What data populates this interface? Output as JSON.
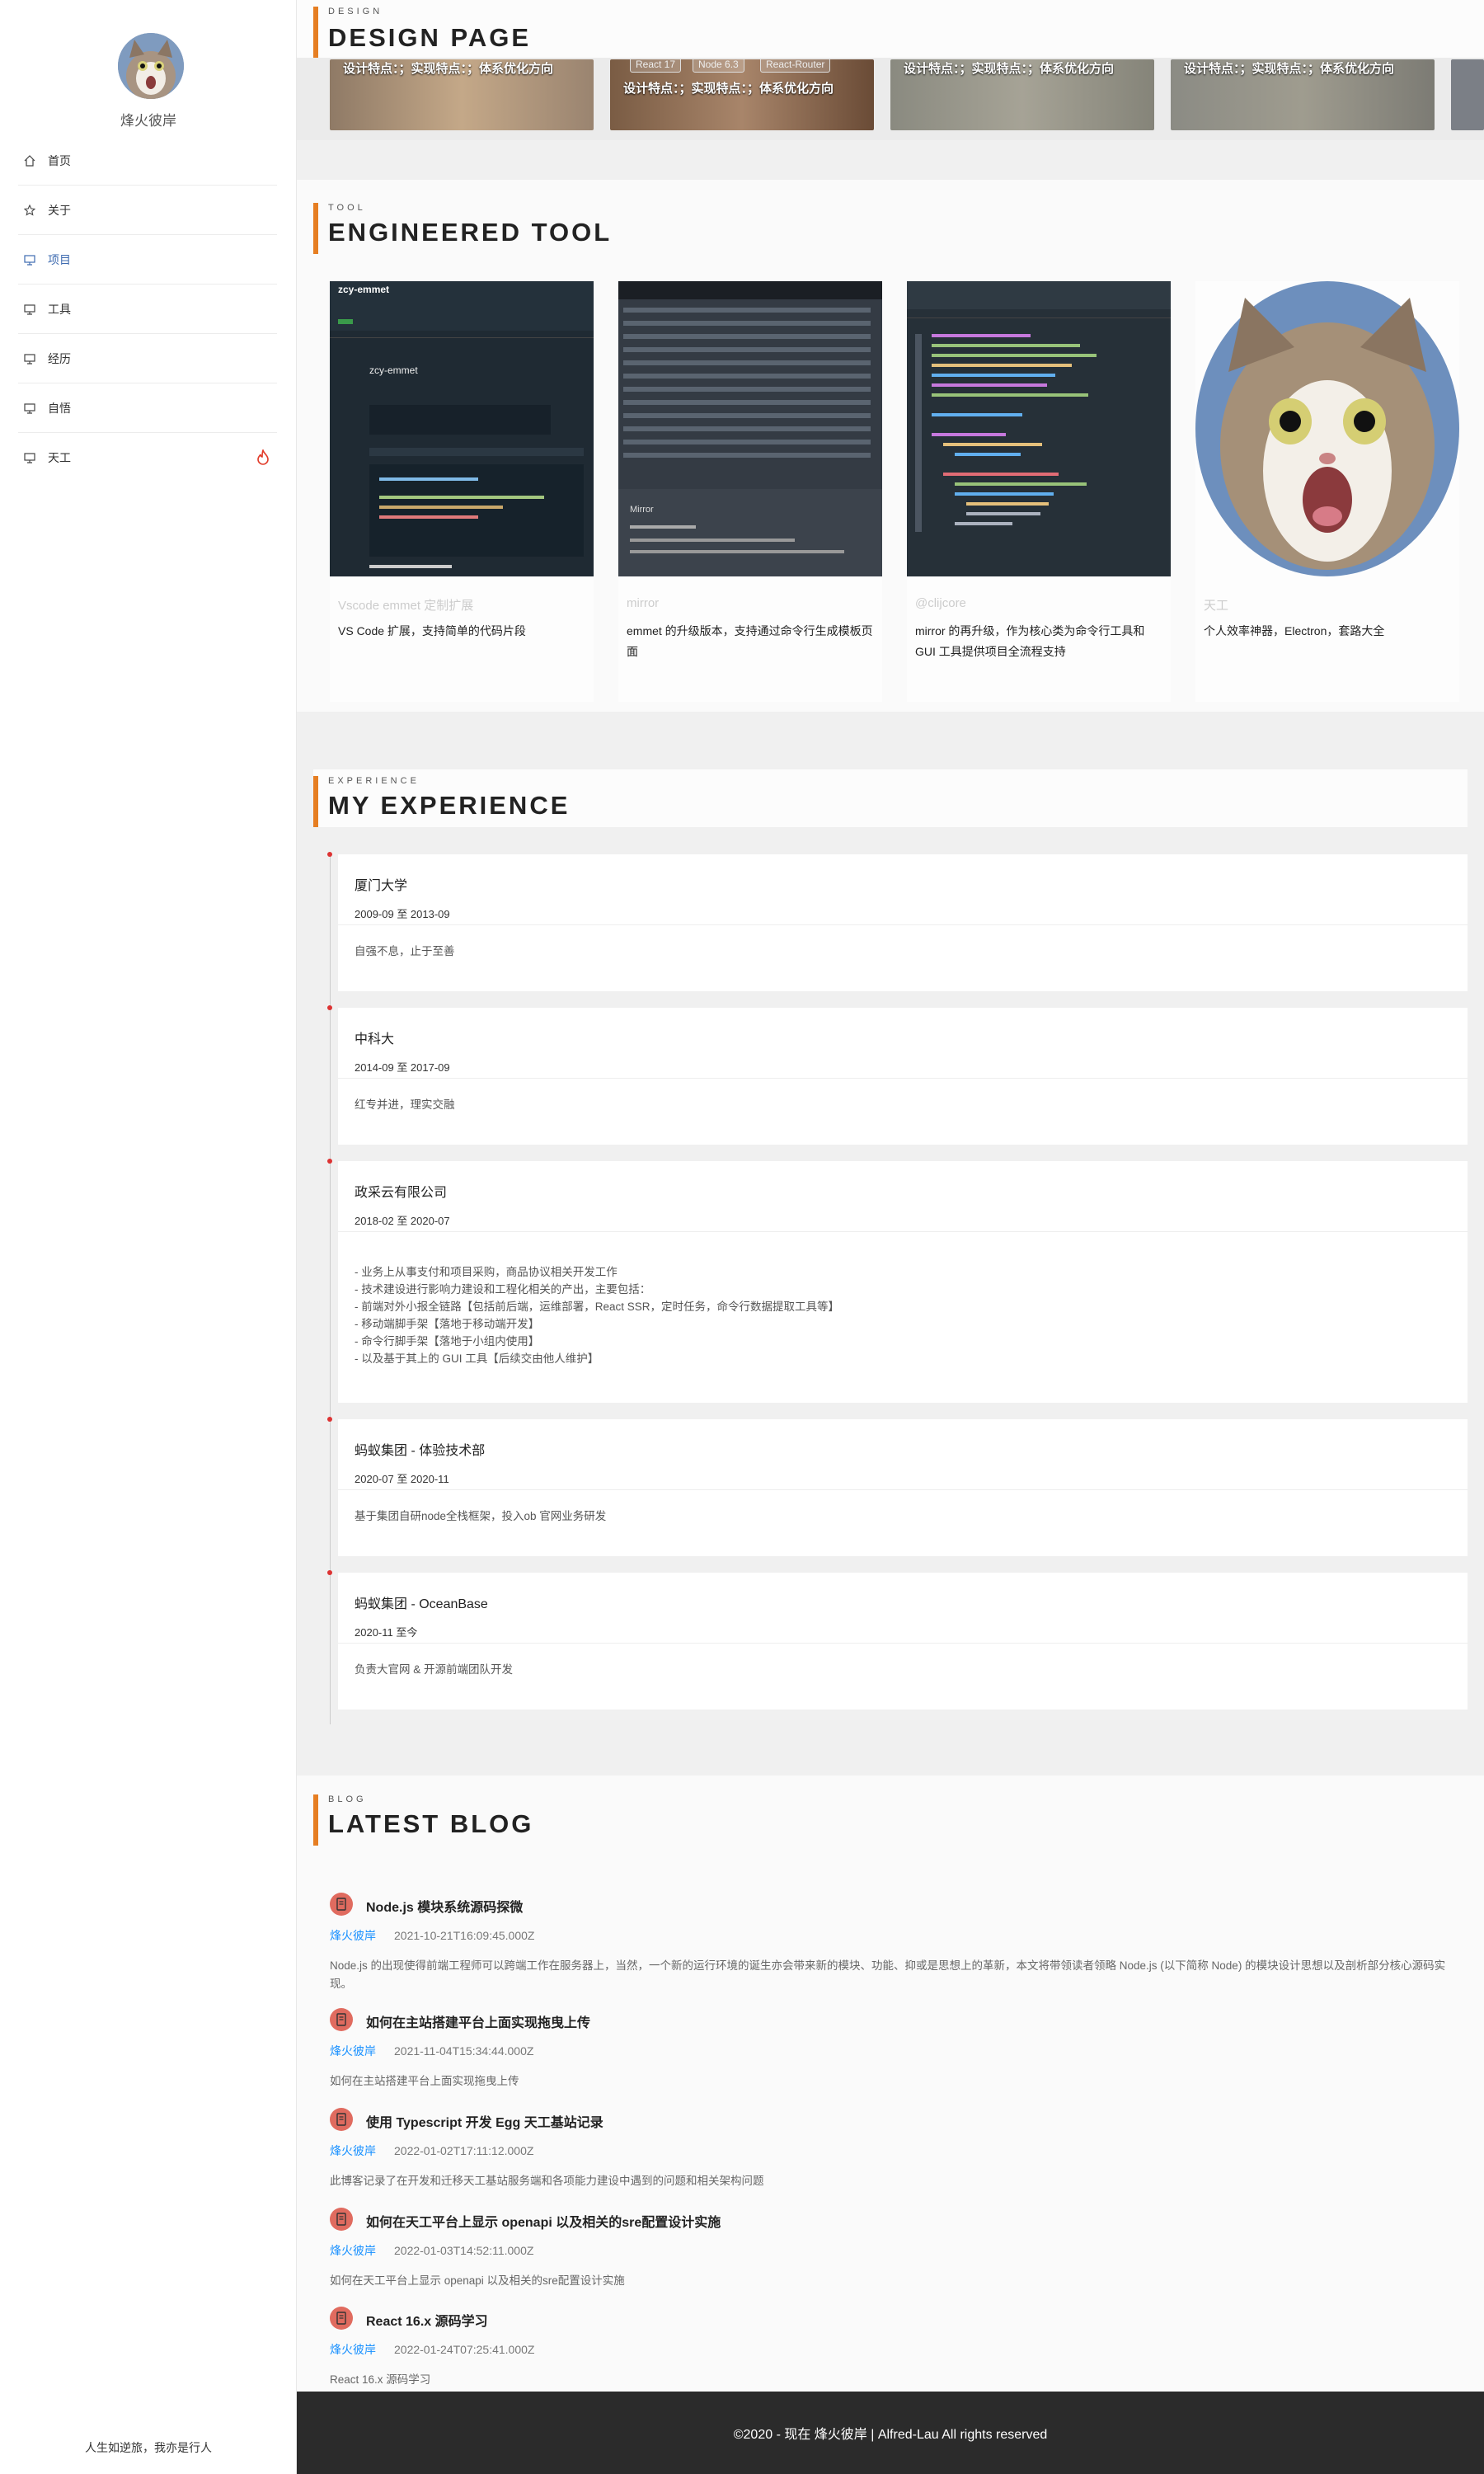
{
  "sidebar": {
    "author": "烽火彼岸",
    "nav": [
      {
        "label": "首页",
        "icon": "home-icon"
      },
      {
        "label": "关于",
        "icon": "star-icon"
      },
      {
        "label": "项目",
        "icon": "monitor-icon",
        "active": true
      },
      {
        "label": "工具",
        "icon": "monitor-icon"
      },
      {
        "label": "经历",
        "icon": "monitor-icon"
      },
      {
        "label": "自悟",
        "icon": "monitor-icon"
      },
      {
        "label": "天工",
        "icon": "monitor-icon",
        "hot": true
      }
    ],
    "motto": "人生如逆旅，我亦是行人"
  },
  "design": {
    "small": "DESIGN",
    "big": "DESIGN PAGE",
    "card_text": "设计特点：；实现特点：；体系优化方向",
    "tags": [
      "React 17",
      "Node 6.3",
      "React-Router"
    ]
  },
  "tool": {
    "small": "TOOL",
    "big": "ENGINEERED TOOL",
    "cards": [
      {
        "name": "Vscode emmet 定制扩展",
        "desc": "VS Code 扩展，支持简单的代码片段",
        "shot": "zcy-emmet"
      },
      {
        "name": "mirror",
        "desc": "emmet 的升级版本，支持通过命令行生成模板页面",
        "shot": "Mirror"
      },
      {
        "name": "@clijcore",
        "desc": "mirror 的再升级，作为核心类为命令行工具和 GUI 工具提供项目全流程支持",
        "shot": "code"
      },
      {
        "name": "天工",
        "desc": "个人效率神器，Electron，套路大全",
        "shot": "cat"
      }
    ]
  },
  "experience": {
    "small": "EXPERIENCE",
    "big": "MY EXPERIENCE",
    "items": [
      {
        "title": "厦门大学",
        "date": "2009-09 至 2013-09",
        "body": "自强不息，止于至善"
      },
      {
        "title": "中科大",
        "date": "2014-09 至 2017-09",
        "body": "红专并进，理实交融"
      },
      {
        "title": "政采云有限公司",
        "date": "2018-02 至 2020-07",
        "body": "- 业务上从事支付和项目采购，商品协议相关开发工作\n- 技术建设进行影响力建设和工程化相关的产出，主要包括：\n- 前端对外小报全链路【包括前后端，运维部署，React SSR，定时任务，命令行数据提取工具等】\n- 移动端脚手架【落地于移动端开发】\n- 命令行脚手架【落地于小组内使用】\n- 以及基于其上的 GUI 工具【后续交由他人维护】"
      },
      {
        "title": "蚂蚁集团 - 体验技术部",
        "date": "2020-07 至 2020-11",
        "body": "基于集团自研node全栈框架，投入ob 官网业务研发"
      },
      {
        "title": "蚂蚁集团 - OceanBase",
        "date": "2020-11 至今",
        "body": "负责大官网 & 开源前端团队开发"
      }
    ]
  },
  "blog": {
    "small": "BLOG",
    "big": "LATEST BLOG",
    "posts": [
      {
        "title": "Node.js 模块系统源码探微",
        "author": "烽火彼岸",
        "date": "2021-10-21T16:09:45.000Z",
        "summary": "Node.js 的出现使得前端工程师可以跨端工作在服务器上，当然，一个新的运行环境的诞生亦会带来新的模块、功能、抑或是思想上的革新，本文将带领读者领略 Node.js (以下简称 Node) 的模块设计思想以及剖析部分核心源码实现。"
      },
      {
        "title": "如何在主站搭建平台上面实现拖曳上传",
        "author": "烽火彼岸",
        "date": "2021-11-04T15:34:44.000Z",
        "summary": "如何在主站搭建平台上面实现拖曳上传"
      },
      {
        "title": "使用 Typescript 开发 Egg 天工基站记录",
        "author": "烽火彼岸",
        "date": "2022-01-02T17:11:12.000Z",
        "summary": "此博客记录了在开发和迁移天工基站服务端和各项能力建设中遇到的问题和相关架构问题"
      },
      {
        "title": "如何在天工平台上显示 openapi 以及相关的sre配置设计实施",
        "author": "烽火彼岸",
        "date": "2022-01-03T14:52:11.000Z",
        "summary": "如何在天工平台上显示 openapi 以及相关的sre配置设计实施"
      },
      {
        "title": "React 16.x 源码学习",
        "author": "烽火彼岸",
        "date": "2022-01-24T07:25:41.000Z",
        "summary": "React 16.x 源码学习"
      }
    ]
  },
  "footer": "©2020 - 现在 烽火彼岸 | Alfred-Lau All rights reserved"
}
